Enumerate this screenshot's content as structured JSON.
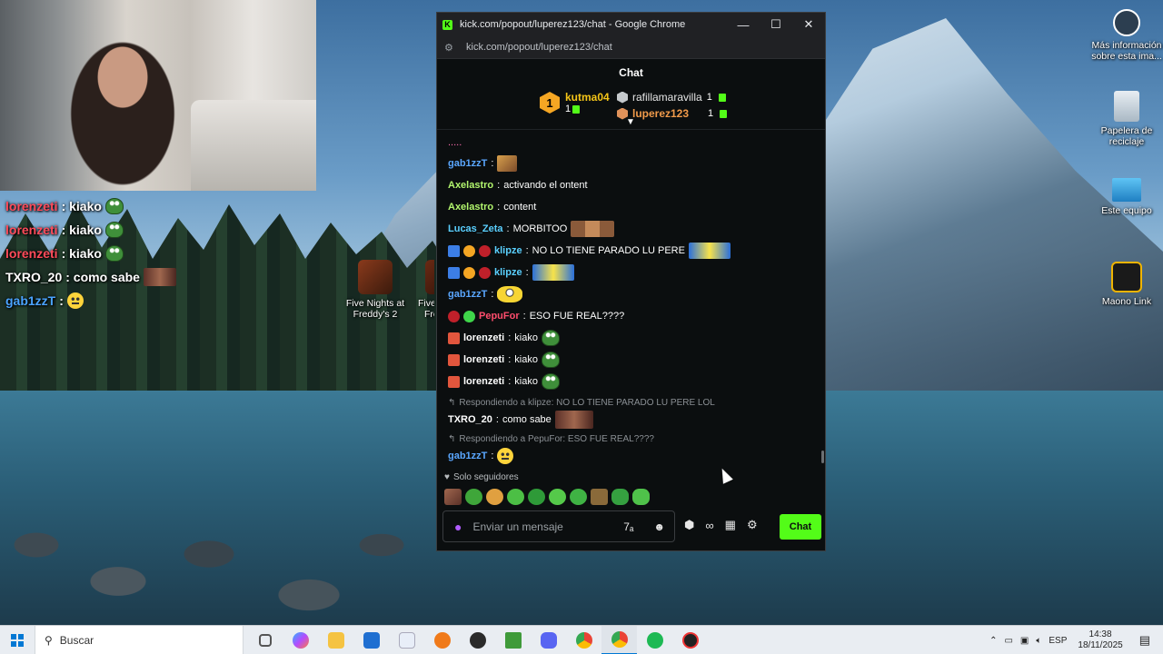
{
  "browser": {
    "window_title": "kick.com/popout/luperez123/chat - Google Chrome",
    "url": "kick.com/popout/luperez123/chat",
    "minimize_label": "—",
    "maximize_label": "☐",
    "close_label": "✕"
  },
  "chat": {
    "header": "Chat",
    "leaderboard": {
      "first": {
        "rank": "1",
        "name": "kutma04",
        "count": "1"
      },
      "second": {
        "name": "rafillamaravilla",
        "count": "1"
      },
      "third": {
        "name": "luperez123",
        "count": "1"
      }
    },
    "messages": [
      {
        "user": "gab1zzT",
        "text": ""
      },
      {
        "user": "Axelastro",
        "text": "activando el ontent"
      },
      {
        "user": "Axelastro",
        "text": "content"
      },
      {
        "user": "Lucas_Zeta",
        "text": "MORBITOO"
      },
      {
        "user": "klipze",
        "text": "NO LO TIENE PARADO LU PERE"
      },
      {
        "user": "klipze",
        "text": ""
      },
      {
        "user": "gab1zzT",
        "text": ""
      },
      {
        "user": "PepuFor",
        "text": "ESO FUE REAL????"
      },
      {
        "user": "lorenzeti",
        "text": "kiako"
      },
      {
        "user": "lorenzeti",
        "text": "kiako"
      },
      {
        "user": "lorenzeti",
        "text": "kiako"
      }
    ],
    "reply1": {
      "text": "Respondiendo a klipze: NO LO TIENE PARADO LU PERE LOL"
    },
    "msg_txro": {
      "user": "TXRO_20",
      "text": "como sabe"
    },
    "reply2": {
      "text": "Respondiendo a PepuFor: ESO FUE REAL????"
    },
    "msg_gab": {
      "user": "gab1zzT"
    },
    "followers_only": "Solo seguidores",
    "input_placeholder": "Enviar un mensaje",
    "send_label": "Chat"
  },
  "overlay": {
    "rows": [
      {
        "user": "lorenzeti",
        "text": ": kiako"
      },
      {
        "user": "lorenzeti",
        "text": ": kiako"
      },
      {
        "user": "lorenzeti",
        "text": ": kiako"
      },
      {
        "user": "TXRO_20",
        "text": ": como sabe"
      },
      {
        "user": "gab1zzT",
        "text": ":"
      }
    ]
  },
  "desktop_icons": {
    "fnaf2": "Five Nights at Freddy's 2",
    "fnaf_partial": "Five",
    "fnaf_partial2": "Fre",
    "bing": "Más información sobre esta ima...",
    "recycle": "Papelera de reciclaje",
    "pc": "Este equipo",
    "maono": "Maono Link"
  },
  "taskbar": {
    "search_label": "Buscar",
    "language": "ESP",
    "time": "14:38",
    "date": "18/11/2025"
  }
}
